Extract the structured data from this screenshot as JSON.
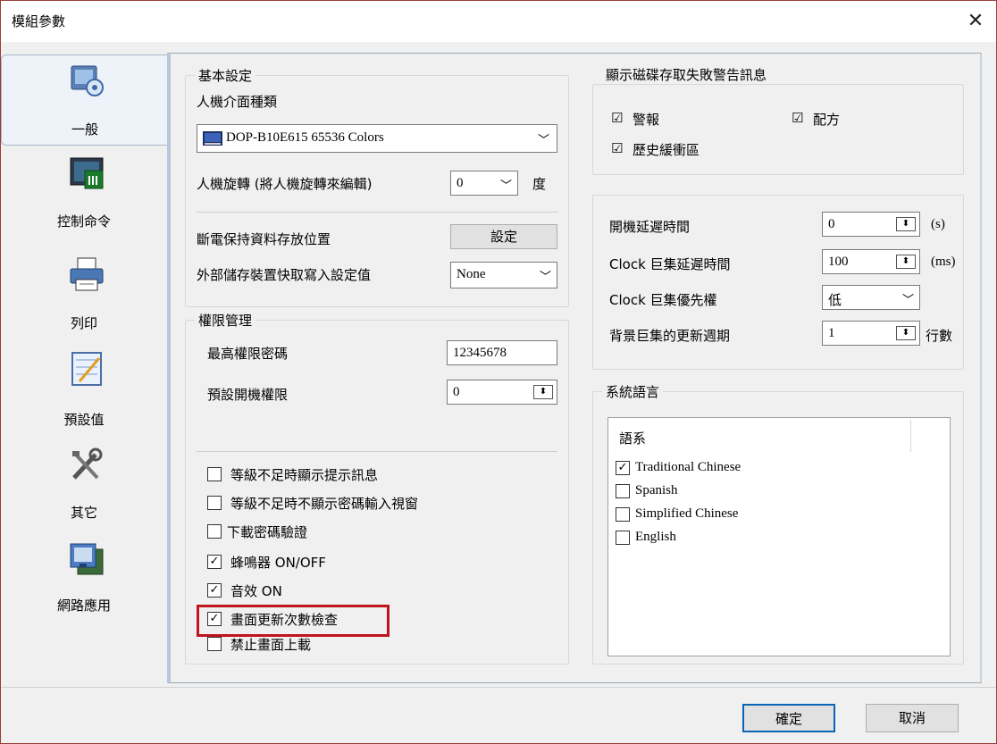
{
  "window": {
    "title": "模組參數",
    "close": "✕"
  },
  "nav": [
    {
      "label": "一般",
      "icon": "general-settings-icon"
    },
    {
      "label": "控制命令",
      "icon": "control-command-icon"
    },
    {
      "label": "列印",
      "icon": "printer-icon"
    },
    {
      "label": "預設值",
      "icon": "default-values-icon"
    },
    {
      "label": "其它",
      "icon": "tools-icon"
    },
    {
      "label": "網路應用",
      "icon": "network-icon"
    }
  ],
  "basic": {
    "group_label": "基本設定",
    "hmi_type_label": "人機介面種類",
    "hmi_type_value": "DOP-B10E615 65536 Colors",
    "rotate_label": "人機旋轉 (將人機旋轉來編輯)",
    "rotate_value": "0",
    "rotate_unit": "度",
    "power_retain_label": "斷電保持資料存放位置",
    "set_button": "設定",
    "ext_storage_label": "外部儲存裝置快取寫入設定值",
    "ext_storage_value": "None"
  },
  "permission": {
    "group_label": "權限管理",
    "max_pwd_label": "最高權限密碼",
    "max_pwd_value": "12345678",
    "default_level_label": "預設開機權限",
    "default_level_value": "0",
    "options": [
      {
        "label": "等級不足時顯示提示訊息",
        "checked": false
      },
      {
        "label": "等級不足時不顯示密碼輸入視窗",
        "checked": false
      },
      {
        "label": "下載密碼驗證",
        "checked": false
      },
      {
        "label": "蜂鳴器 ON/OFF",
        "checked": true
      },
      {
        "label": "音效 ON",
        "checked": true
      },
      {
        "label": "畫面更新次數檢查",
        "checked": true
      },
      {
        "label": "禁止畫面上載",
        "checked": false
      }
    ]
  },
  "disk_warn": {
    "group_label": "顯示磁碟存取失敗警告訊息",
    "alarm": "警報",
    "recipe": "配方",
    "history": "歷史緩衝區",
    "check": "☑"
  },
  "timing": {
    "boot_delay_label": "開機延遲時間",
    "boot_delay_value": "0",
    "boot_delay_unit": "(s)",
    "clock_delay_label": "Clock 巨集延遲時間",
    "clock_delay_value": "100",
    "clock_delay_unit": "(ms)",
    "clock_priority_label": "Clock 巨集優先權",
    "clock_priority_value": "低",
    "bg_period_label": "背景巨集的更新週期",
    "bg_period_value": "1",
    "bg_period_unit": "行數"
  },
  "language": {
    "group_label": "系統語言",
    "header": "語系",
    "items": [
      {
        "label": "Traditional Chinese",
        "checked": true
      },
      {
        "label": "Spanish",
        "checked": false
      },
      {
        "label": "Simplified Chinese",
        "checked": false
      },
      {
        "label": "English",
        "checked": false
      }
    ]
  },
  "footer": {
    "ok": "確定",
    "cancel": "取消"
  },
  "glyphs": {
    "arrow": "﹀",
    "spin": "⬍",
    "check": "✓"
  }
}
